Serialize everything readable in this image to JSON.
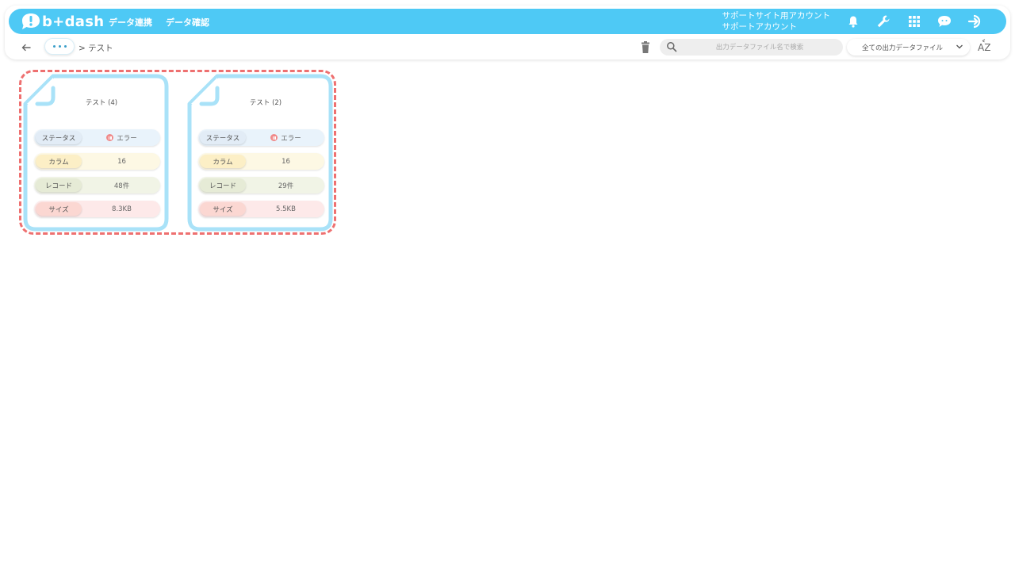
{
  "app": {
    "logo_text": "b+dash",
    "nav": [
      "データ連携",
      "データ確認"
    ],
    "account": {
      "line1": "サポートサイト用アカウント",
      "line2": "サポートアカウント"
    },
    "topbar_color": "#4ec9f5"
  },
  "toolbar": {
    "breadcrumb": "> テスト",
    "search_placeholder": "出力データファイル名で検索",
    "filter_selected": "全ての出力データファイル",
    "sort_label": "AZ"
  },
  "cards": [
    {
      "title": "テスト (4)",
      "rows": [
        {
          "label": "ステータス",
          "value": "エラー"
        },
        {
          "label": "カラム",
          "value": "16"
        },
        {
          "label": "レコード",
          "value": "48件"
        },
        {
          "label": "サイズ",
          "value": "8.3KB"
        }
      ]
    },
    {
      "title": "テスト (2)",
      "rows": [
        {
          "label": "ステータス",
          "value": "エラー"
        },
        {
          "label": "カラム",
          "value": "16"
        },
        {
          "label": "レコード",
          "value": "29件"
        },
        {
          "label": "サイズ",
          "value": "5.5KB"
        }
      ]
    }
  ],
  "colors": {
    "status_bg": "#e9f3fb",
    "column_bg": "#fdf8e4",
    "record_bg": "#f1f4e6",
    "size_bg": "#fde9e9",
    "card_border": "#a9e2f8",
    "selection_border": "#ee7070"
  }
}
